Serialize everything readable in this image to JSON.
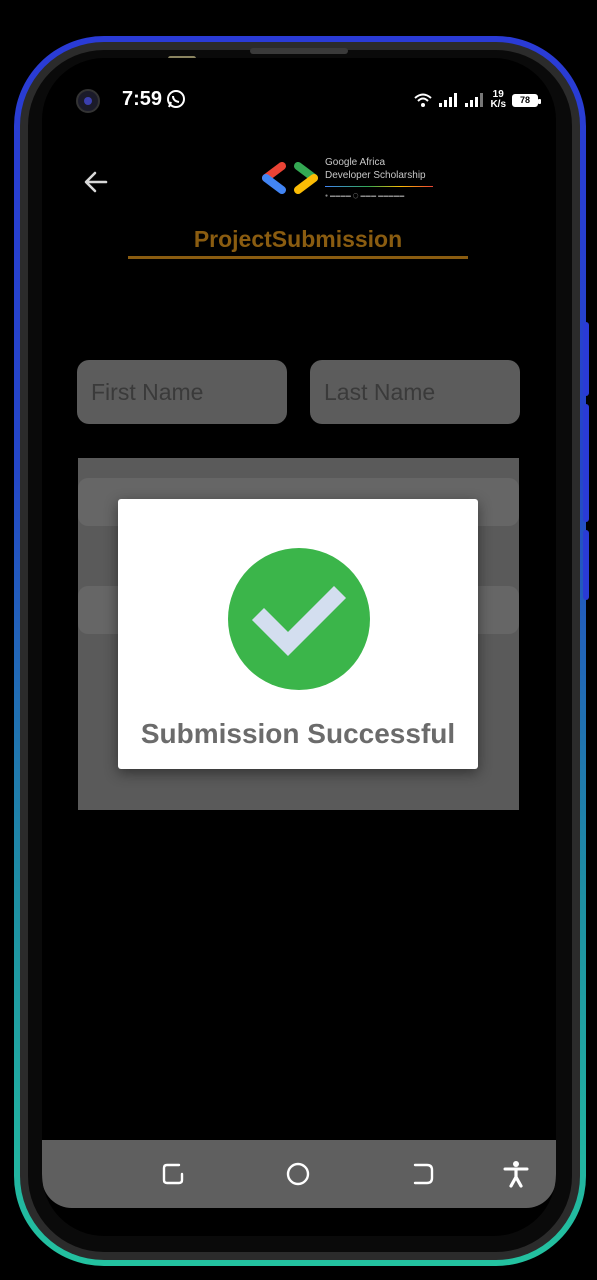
{
  "status_bar": {
    "time": "7:59",
    "net_speed_value": "19",
    "net_speed_unit": "K/s",
    "battery": "78",
    "icons": [
      "whatsapp-icon",
      "wifi-icon",
      "signal-icon",
      "signal-icon",
      "battery-icon"
    ]
  },
  "header": {
    "logo_line1": "Google Africa",
    "logo_line2": "Developer Scholarship",
    "title": "ProjectSubmission",
    "title_color": "#8a5c10"
  },
  "form": {
    "first_name_placeholder": "First Name",
    "last_name_placeholder": "Last Name"
  },
  "dialog": {
    "message": "Submission Successful",
    "icon": "check-circle-icon",
    "success_color": "#3bb54a"
  },
  "nav_bar": {
    "icons": [
      "recent-apps-icon",
      "home-icon",
      "back-icon",
      "accessibility-icon"
    ]
  }
}
